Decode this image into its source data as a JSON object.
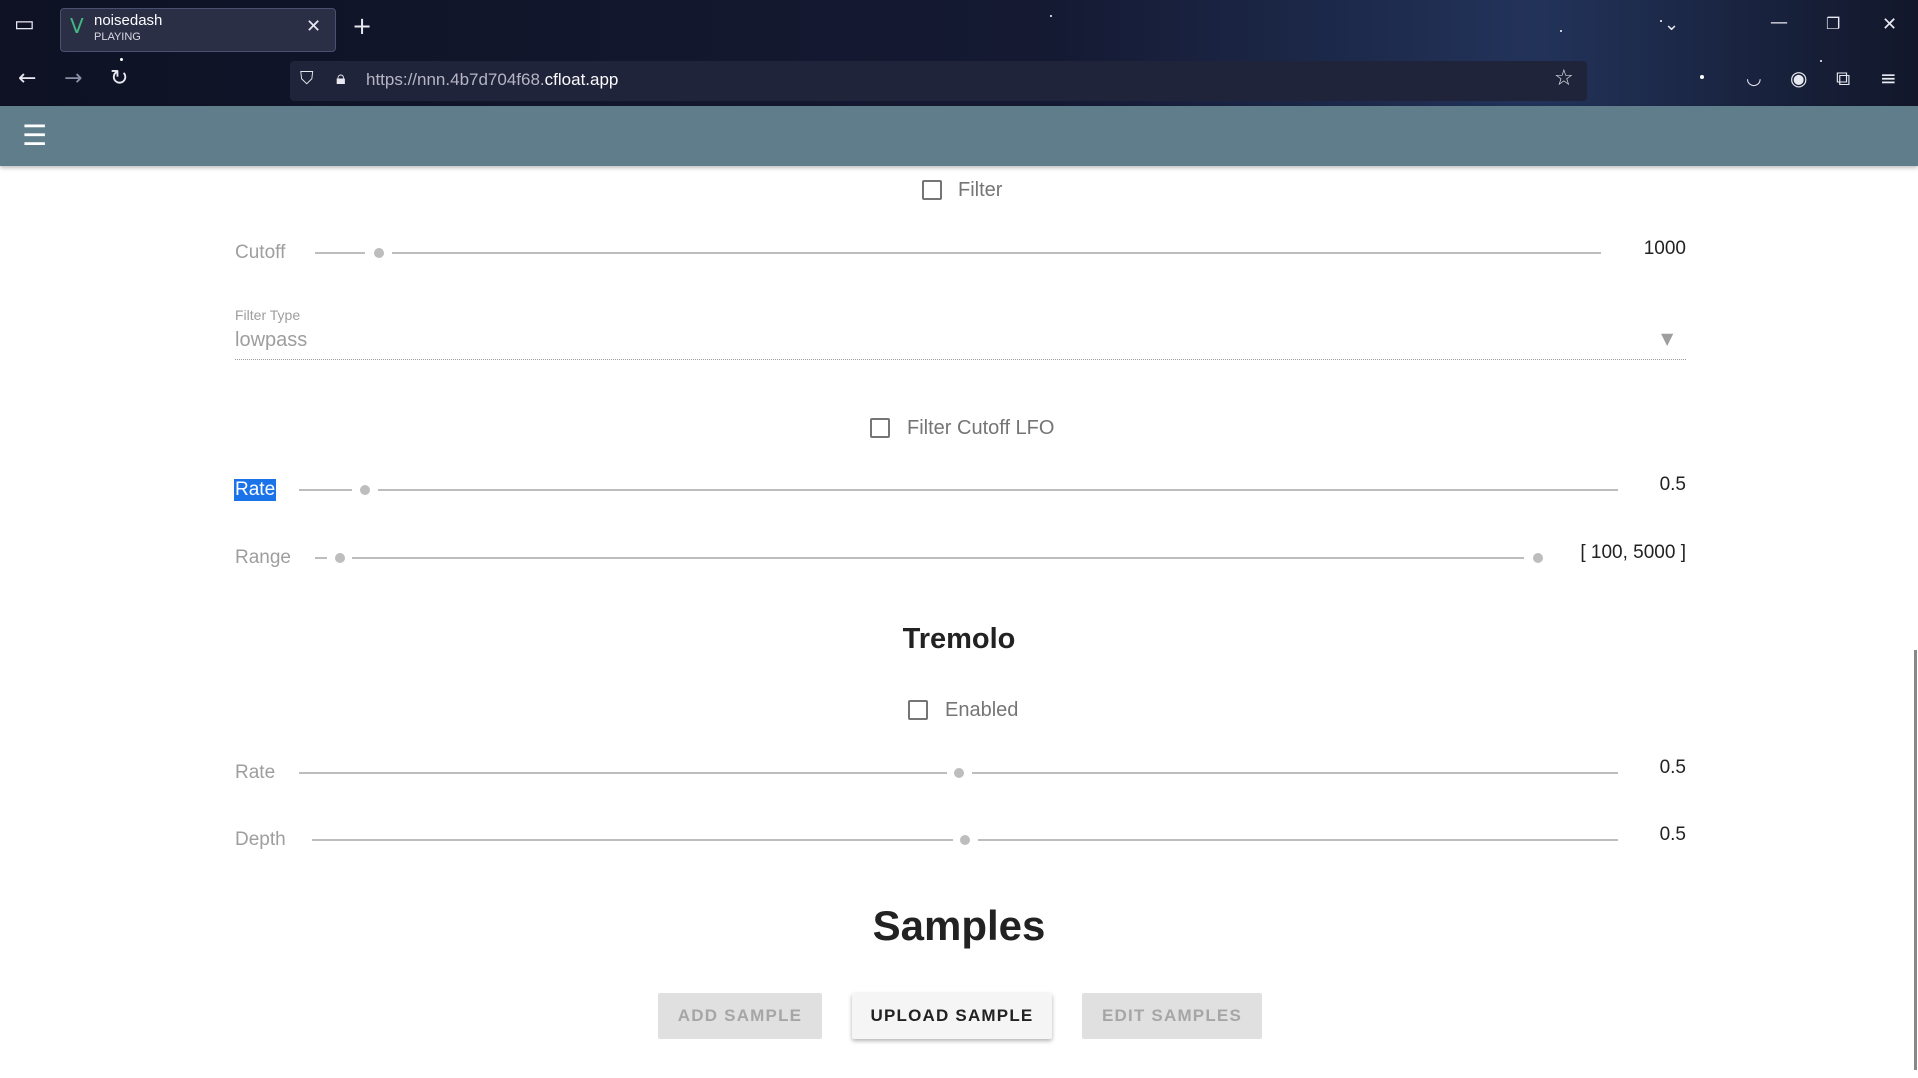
{
  "browser": {
    "tab": {
      "title": "noisedash",
      "subtitle": "PLAYING"
    },
    "url": {
      "prefix": "https://nnn.4b7d704f68.",
      "domain": "cfloat.app"
    }
  },
  "filter": {
    "checkbox_label": "Filter",
    "cutoff": {
      "label": "Cutoff",
      "value": "1000"
    },
    "filter_type": {
      "label": "Filter Type",
      "value": "lowpass"
    },
    "lfo": {
      "checkbox_label": "Filter Cutoff LFO",
      "rate": {
        "label": "Rate",
        "value": "0.5"
      },
      "range": {
        "label": "Range",
        "value": "[ 100, 5000 ]"
      }
    }
  },
  "tremolo": {
    "heading": "Tremolo",
    "checkbox_label": "Enabled",
    "rate": {
      "label": "Rate",
      "value": "0.5"
    },
    "depth": {
      "label": "Depth",
      "value": "0.5"
    }
  },
  "samples": {
    "heading": "Samples",
    "buttons": {
      "add": "ADD SAMPLE",
      "upload": "UPLOAD SAMPLE",
      "edit": "EDIT SAMPLES"
    }
  },
  "icons": {
    "tab_list": "tab-list-icon",
    "vue_logo": "vue-logo-icon",
    "close": "close-icon",
    "new_tab": "plus-icon",
    "back": "back-arrow-icon",
    "forward": "forward-arrow-icon",
    "reload": "reload-icon",
    "shield": "shield-icon",
    "lock": "lock-icon",
    "star": "star-icon",
    "pocket": "pocket-icon",
    "account": "account-icon",
    "extensions": "extensions-icon",
    "menu": "hamburger-icon"
  },
  "colors": {
    "appbar": "#607d8b",
    "selection": "#1a73e8"
  }
}
